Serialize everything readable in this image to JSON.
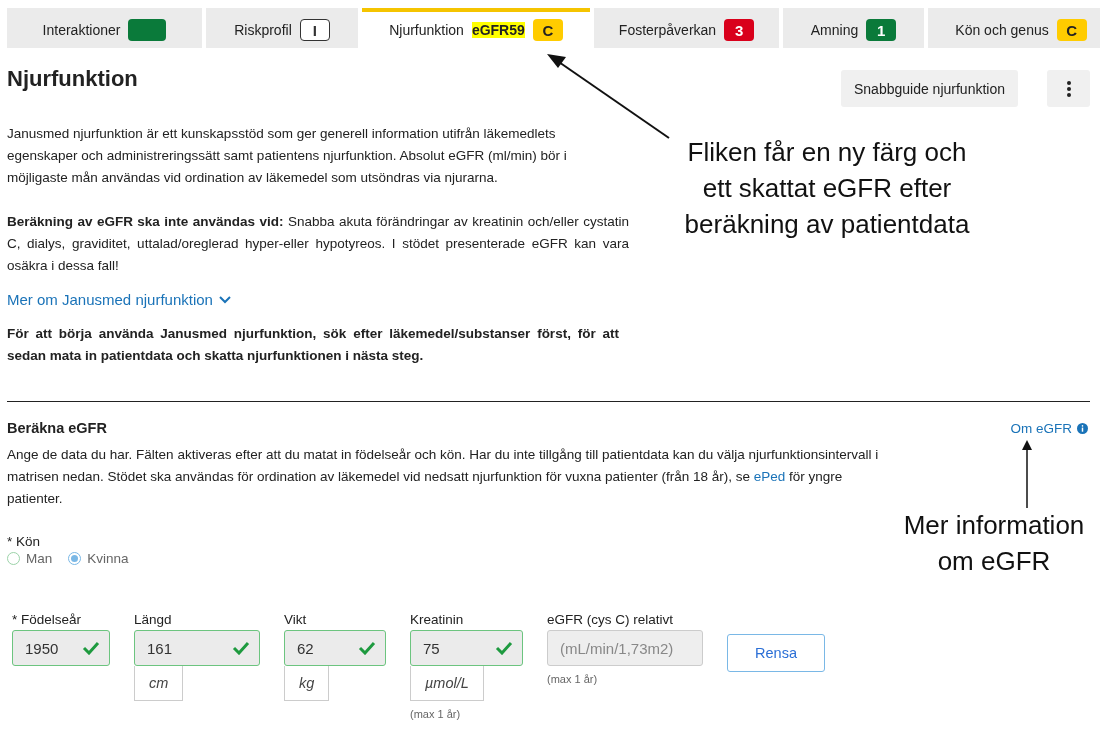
{
  "tabs": [
    {
      "label": "Interaktioner",
      "selected": false,
      "badge": {
        "kind": "filled",
        "color": "#0a7a3a"
      }
    },
    {
      "label": "Riskprofil",
      "selected": false,
      "badge": {
        "kind": "outline",
        "text": "I",
        "color": "#333333"
      }
    },
    {
      "label": "Njurfunktion",
      "selected": true,
      "highlight": "eGFR59",
      "badge": {
        "kind": "filled",
        "text": "C",
        "color": "#ffcc00"
      }
    },
    {
      "label": "Fosterpåverkan",
      "selected": false,
      "badge": {
        "kind": "filled",
        "text": "3",
        "color": "#d9001b"
      }
    },
    {
      "label": "Amning",
      "selected": false,
      "badge": {
        "kind": "filled",
        "text": "1",
        "color": "#0a7a3a"
      }
    },
    {
      "label": "Kön och genus",
      "selected": false,
      "badge": {
        "kind": "filled",
        "text": "C",
        "color": "#ffcc00"
      }
    }
  ],
  "page": {
    "title": "Njurfunktion",
    "guide_button": "Snabbguide njurfunktion",
    "paragraphs": [
      {
        "kind": "plain",
        "text": "Janusmed njurfunktion är ett kunskapsstöd som ger generell information utifrån läkemedlets egenskaper och administreringssätt samt patientens njurfunktion. Absolut eGFR (ml/min) bör i möjligaste mån användas vid ordination av läkemedel som utsöndras via njurarna."
      },
      {
        "kind": "justified",
        "text": "**Beräkning av eGFR ska inte användas vid:** Snabba akuta förändringar av kreatinin och/eller cystatin C, dialys, graviditet, uttalad/oreglerad hyper-eller hypotyreos. I stödet presenterade eGFR kan vara osäkra i dessa fall!"
      },
      {
        "kind": "expander",
        "text": "Mer om Janusmed njurfunktion",
        "expanded": false
      },
      {
        "kind": "strong",
        "text": "För att börja använda Janusmed njurfunktion, sök efter läkemedel/substanser först, för att sedan mata in patientdata och skatta njurfunktionen i nästa steg."
      }
    ]
  },
  "egfr": {
    "title": "Beräkna eGFR",
    "info_link": "Om eGFR",
    "description": {
      "before": "Ange de data du har. Fälten aktiveras efter att du matat in födelseår och kön. Har du inte tillgång till patientdata kan du välja njurfunktionsintervall i matrisen nedan. Stödet ska användas för ordination av läkemedel vid nedsatt njurfunktion för vuxna patienter (från 18 år), se ",
      "link": "ePed",
      "after": " för yngre patienter."
    },
    "sex": {
      "label": "* Kön",
      "options": [
        {
          "label": "Man",
          "selected": false
        },
        {
          "label": "Kvinna",
          "selected": true
        }
      ]
    },
    "fields": [
      {
        "label": "* Födelseår",
        "value": "1950",
        "valid": true,
        "disabled": false
      },
      {
        "label": "Längd",
        "value": "161",
        "valid": true,
        "disabled": false,
        "unit": "cm"
      },
      {
        "label": "Vikt",
        "value": "62",
        "valid": true,
        "disabled": false,
        "unit": "kg"
      },
      {
        "label": "Kreatinin",
        "value": "75",
        "valid": true,
        "disabled": false,
        "unit": "µmol/L",
        "note": "(max 1 år)"
      },
      {
        "label": "eGFR (cys C) relativt",
        "placeholder": "(mL/min/1,73m2)",
        "valid": false,
        "disabled": true,
        "note": "(max 1 år)"
      }
    ],
    "clear_button": "Rensa"
  },
  "annotations": [
    {
      "text": "Fliken får en ny färg och ett skattat eGFR efter beräkning av patientdata",
      "kind": "tab"
    },
    {
      "text": "Mer information om eGFR",
      "kind": "info"
    }
  ]
}
